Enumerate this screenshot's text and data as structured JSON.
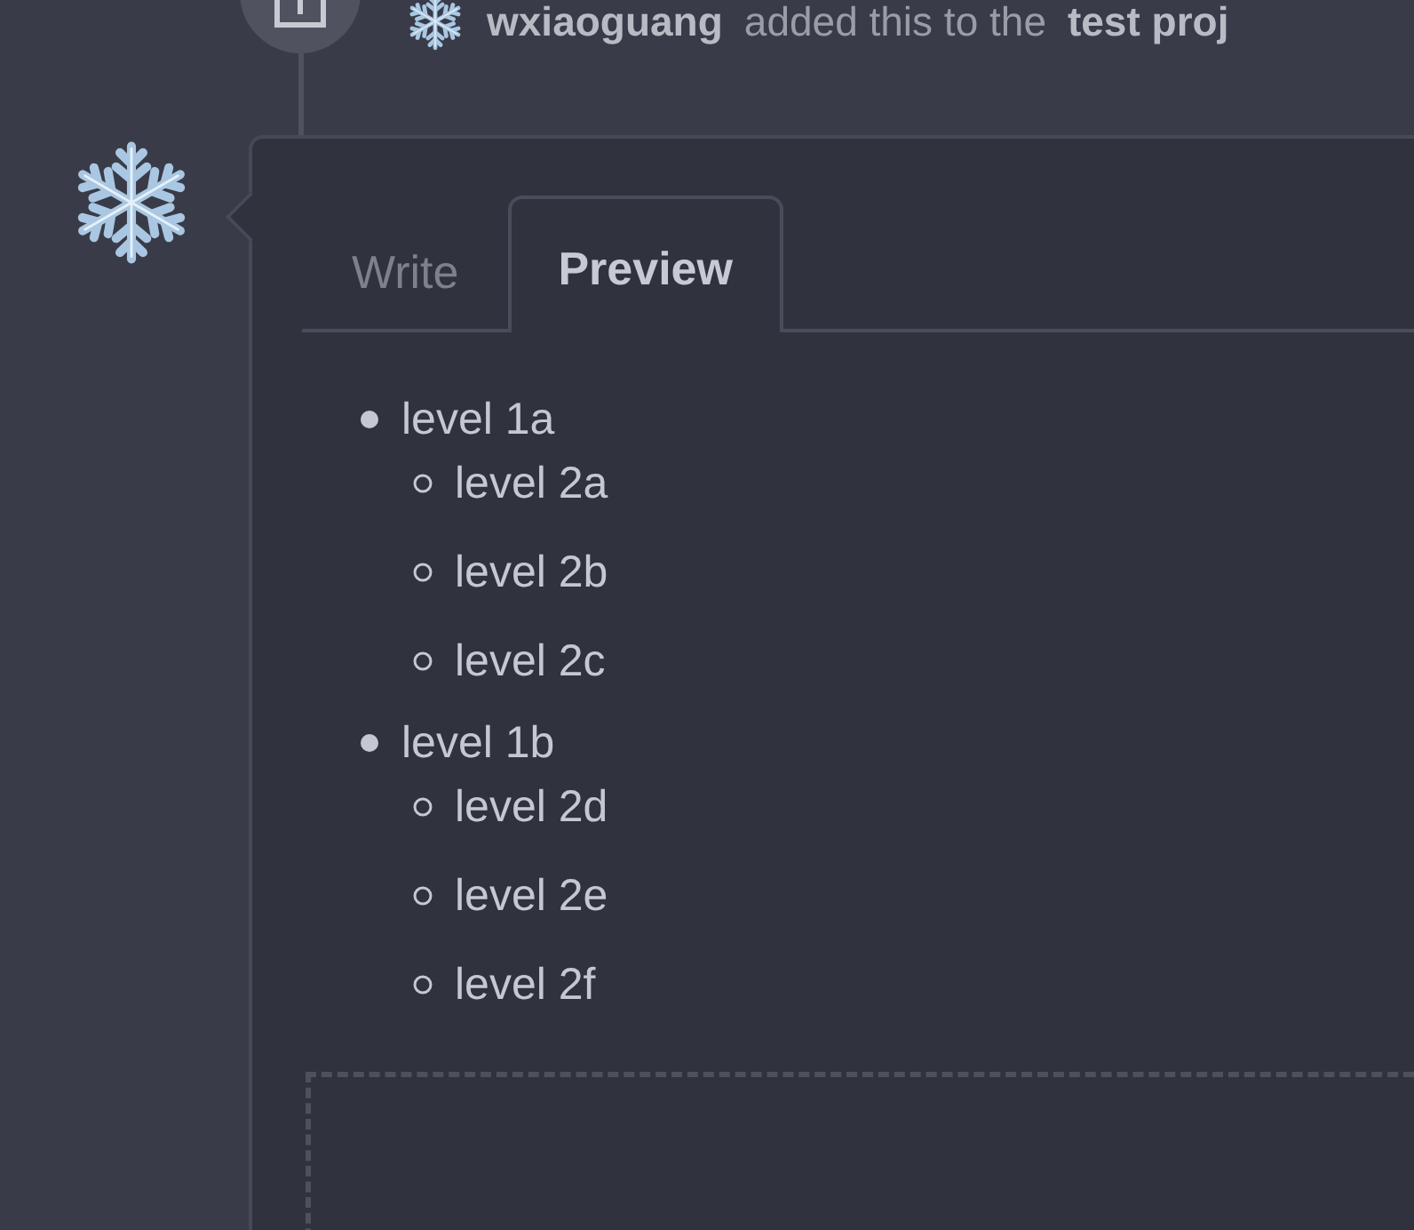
{
  "timeline_event": {
    "user": "wxiaoguang",
    "action": "added this to the",
    "target": "test proj"
  },
  "editor": {
    "tabs": [
      {
        "label": "Write",
        "selected": false
      },
      {
        "label": "Preview",
        "selected": true
      }
    ],
    "preview_list": [
      {
        "text": "level 1a",
        "children": [
          {
            "text": "level 2a"
          },
          {
            "text": "level 2b"
          },
          {
            "text": "level 2c"
          }
        ]
      },
      {
        "text": "level 1b",
        "children": [
          {
            "text": "level 2d"
          },
          {
            "text": "level 2e"
          },
          {
            "text": "level 2f"
          }
        ]
      }
    ]
  }
}
